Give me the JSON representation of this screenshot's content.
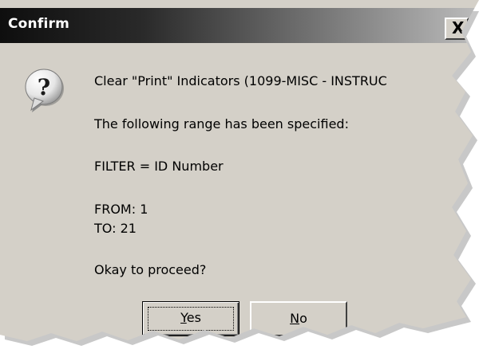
{
  "window": {
    "title": "Confirm",
    "close_glyph": "X"
  },
  "icon": {
    "name": "question-icon"
  },
  "message": {
    "line1": "Clear \"Print\" Indicators (1099-MISC - INSTRUC",
    "line2": "The following range has been specified:",
    "line3": "FILTER = ID Number",
    "line4": "FROM:  1",
    "line5": "TO:  21",
    "line6": "Okay to proceed?"
  },
  "buttons": {
    "yes": {
      "mnemonic": "Y",
      "rest": "es"
    },
    "no": {
      "mnemonic": "N",
      "rest": "o"
    }
  },
  "colors": {
    "dialog_bg": "#d4d0c8",
    "titlebar_start": "#0e0e0e",
    "titlebar_end": "#bcbcbc",
    "title_text": "#ffffff"
  }
}
